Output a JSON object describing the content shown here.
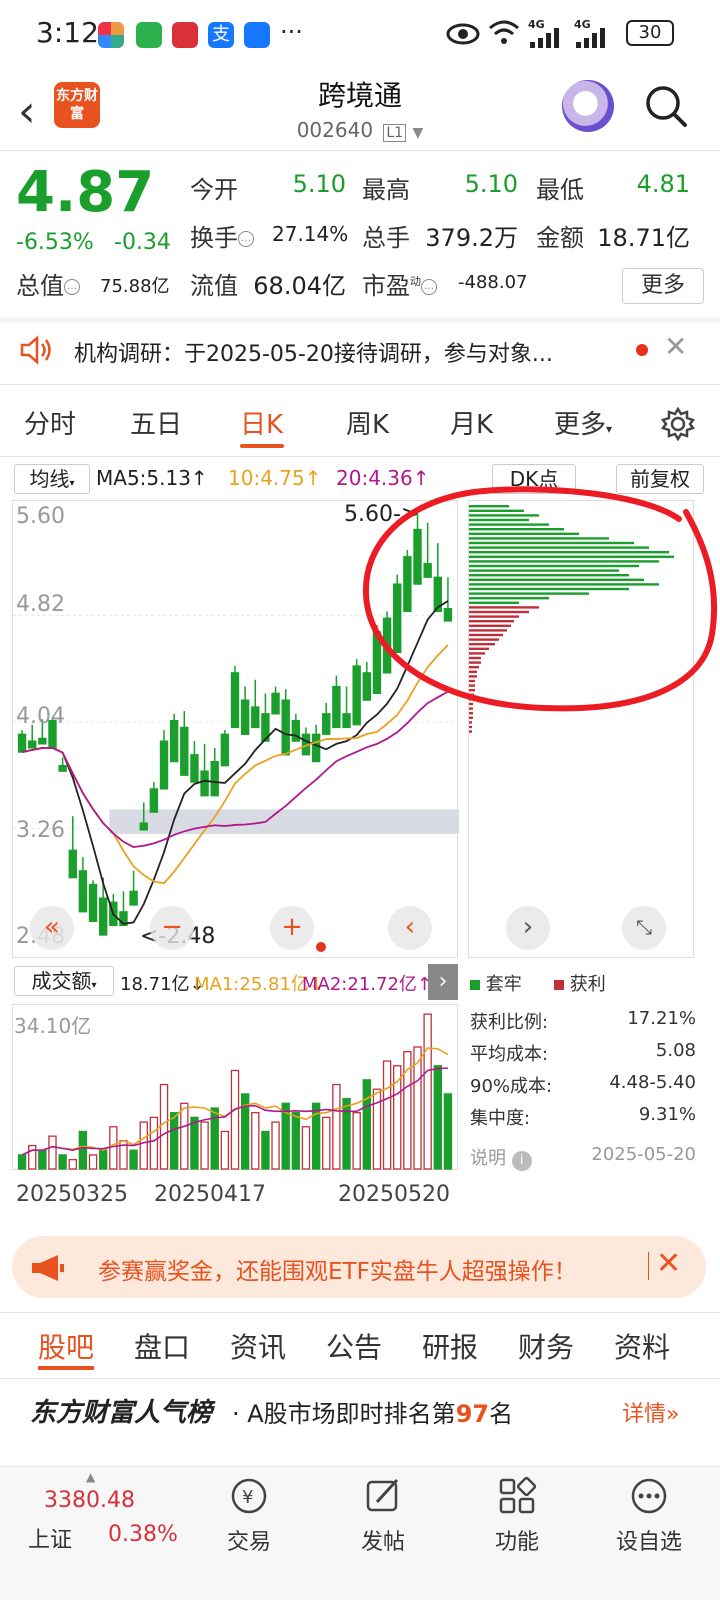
{
  "status_bar": {
    "time": "3:12",
    "battery": "30",
    "more": "···",
    "net_a": "4G",
    "net_b": "4G"
  },
  "header": {
    "title": "跨境通",
    "code": "002640",
    "level": "L1",
    "logo_text": "东方财富"
  },
  "quote": {
    "price": "4.87",
    "change_pct": "-6.53%",
    "change_amt": "-0.34",
    "open_label": "今开",
    "open": "5.10",
    "high_label": "最高",
    "high": "5.10",
    "low_label": "最低",
    "low": "4.81",
    "turnover_label": "换手",
    "turnover": "27.14%",
    "volume_label": "总手",
    "volume": "379.2万",
    "amount_label": "金额",
    "amount": "18.71亿",
    "mktcap_label": "总值",
    "mktcap": "75.88亿",
    "float_label": "流值",
    "float": "68.04亿",
    "pe_label": "市盈",
    "pe_sup": "动",
    "pe": "-488.07",
    "more_label": "更多"
  },
  "notice": {
    "text": "机构调研：于2025-05-20接待调研，参与对象..."
  },
  "tabs": {
    "items": [
      "分时",
      "五日",
      "日K",
      "周K",
      "月K",
      "更多"
    ]
  },
  "chart_controls": {
    "ma_select": "均线",
    "ma5": "MA5:5.13↑",
    "ma10": "10:4.75↑",
    "ma20": "20:4.36↑",
    "dk": "DK点",
    "fq": "前复权",
    "vol_select": "成交额",
    "vol_val": "18.71亿↓",
    "vol_ma1": "MA1:25.81亿↓",
    "vol_ma2": "MA2:21.72亿↑"
  },
  "chart_data": {
    "type": "candlestick",
    "y_ticks": [
      "5.60",
      "4.82",
      "4.04",
      "3.26",
      "2.48"
    ],
    "ylim": [
      2.48,
      5.6
    ],
    "high_mark": "5.60->",
    "low_mark": "<-2.48",
    "vol_top": "34.10亿",
    "dates": [
      "20250325",
      "20250417",
      "20250520"
    ],
    "candles": [
      [
        3.95,
        3.98,
        3.85,
        3.82
      ],
      [
        3.9,
        4.02,
        3.88,
        3.85
      ],
      [
        3.92,
        4.06,
        3.9,
        3.88
      ],
      [
        4.05,
        4.08,
        3.88,
        3.85
      ],
      [
        3.72,
        3.78,
        3.7,
        3.68
      ],
      [
        3.1,
        3.35,
        2.95,
        2.9
      ],
      [
        2.95,
        3.05,
        2.7,
        2.65
      ],
      [
        2.85,
        2.88,
        2.6,
        2.58
      ],
      [
        2.75,
        2.9,
        2.55,
        2.48
      ],
      [
        2.72,
        2.78,
        2.58,
        2.55
      ],
      [
        2.65,
        2.8,
        2.6,
        2.55
      ],
      [
        2.8,
        2.95,
        2.72,
        2.7
      ],
      [
        3.3,
        3.45,
        3.28,
        3.25
      ],
      [
        3.55,
        3.6,
        3.4,
        3.38
      ],
      [
        3.9,
        3.98,
        3.6,
        3.55
      ],
      [
        4.05,
        4.1,
        3.78,
        3.75
      ],
      [
        4.0,
        4.12,
        3.7,
        3.65
      ],
      [
        3.8,
        3.9,
        3.65,
        3.6
      ],
      [
        3.68,
        3.88,
        3.52,
        3.5
      ],
      [
        3.75,
        3.85,
        3.55,
        3.5
      ],
      [
        3.95,
        3.98,
        3.75,
        3.72
      ],
      [
        4.4,
        4.45,
        4.05,
        4.0
      ],
      [
        4.2,
        4.3,
        4.0,
        3.95
      ],
      [
        4.15,
        4.35,
        4.05,
        4.0
      ],
      [
        4.1,
        4.25,
        3.95,
        3.9
      ],
      [
        4.25,
        4.3,
        4.15,
        4.1
      ],
      [
        4.2,
        4.28,
        3.85,
        3.8
      ],
      [
        4.05,
        4.1,
        3.95,
        3.9
      ],
      [
        3.95,
        4.0,
        3.85,
        3.8
      ],
      [
        3.95,
        4.02,
        3.8,
        3.75
      ],
      [
        4.1,
        4.18,
        4.0,
        3.95
      ],
      [
        4.3,
        4.38,
        4.02,
        4.0
      ],
      [
        4.1,
        4.3,
        4.05,
        4.0
      ],
      [
        4.45,
        4.5,
        4.05,
        4.02
      ],
      [
        4.4,
        4.48,
        4.22,
        4.2
      ],
      [
        4.7,
        4.75,
        4.3,
        4.25
      ],
      [
        4.8,
        4.85,
        4.42,
        4.4
      ],
      [
        5.05,
        5.12,
        4.6,
        4.55
      ],
      [
        5.25,
        5.3,
        4.9,
        4.85
      ],
      [
        5.45,
        5.6,
        5.1,
        5.05
      ],
      [
        5.2,
        5.5,
        5.15,
        5.1
      ],
      [
        5.1,
        5.35,
        4.9,
        4.85
      ],
      [
        4.87,
        5.1,
        4.81,
        4.78
      ]
    ],
    "volume_up": [
      false,
      true,
      false,
      true,
      false,
      true,
      false,
      true,
      false,
      true,
      true,
      false,
      true,
      true,
      true,
      false,
      true,
      false,
      true,
      false,
      true,
      true,
      false,
      true,
      false,
      true,
      false,
      false,
      true,
      false,
      true,
      true,
      false,
      true,
      false,
      true,
      true,
      true,
      true,
      true,
      true,
      false,
      false
    ],
    "volume": [
      3,
      5,
      4,
      7,
      3,
      2,
      8,
      3,
      4,
      9,
      6,
      4,
      10,
      11,
      18,
      12,
      14,
      11,
      10,
      13,
      8,
      21,
      16,
      12,
      8,
      10,
      14,
      12,
      9,
      14,
      11,
      18,
      15,
      12,
      19,
      17,
      23,
      22,
      25,
      26,
      33,
      22,
      16
    ]
  },
  "dist": {
    "legend_trapped": "套牢",
    "legend_profit": "获利",
    "rows": [
      {
        "label": "获利比例:",
        "value": "17.21%"
      },
      {
        "label": "平均成本:",
        "value": "5.08"
      },
      {
        "label": "90%成本:",
        "value": "4.48-5.40"
      },
      {
        "label": "集中度:",
        "value": "9.31%"
      }
    ],
    "note_label": "说明",
    "note_date": "2025-05-20",
    "green_bars": [
      40,
      55,
      70,
      60,
      80,
      95,
      110,
      140,
      165,
      180,
      200,
      205,
      190,
      170,
      150,
      160,
      175,
      190,
      160,
      120,
      80,
      50
    ],
    "red_bars": [
      70,
      60,
      50,
      45,
      42,
      38,
      34,
      30,
      26,
      20,
      16,
      12,
      12,
      10,
      8,
      8,
      6,
      6,
      6,
      5,
      5,
      4,
      4,
      4,
      4,
      3,
      3,
      3
    ]
  },
  "banner": {
    "text": "参赛赢奖金，还能围观ETF实盘牛人超强操作！"
  },
  "bottom_tabs": {
    "items": [
      "股吧",
      "盘口",
      "资讯",
      "公告",
      "研报",
      "财务",
      "资料"
    ]
  },
  "popularity": {
    "brand": "东方财富人气榜",
    "text_pre": "· A股市场即时排名第",
    "rank": "97",
    "text_post": "名",
    "link": "详情»"
  },
  "bottom_nav": {
    "index_value": "3380.48",
    "index_name": "上证",
    "index_pct": "0.38%",
    "items": [
      "交易",
      "发帖",
      "功能",
      "设自选"
    ]
  }
}
